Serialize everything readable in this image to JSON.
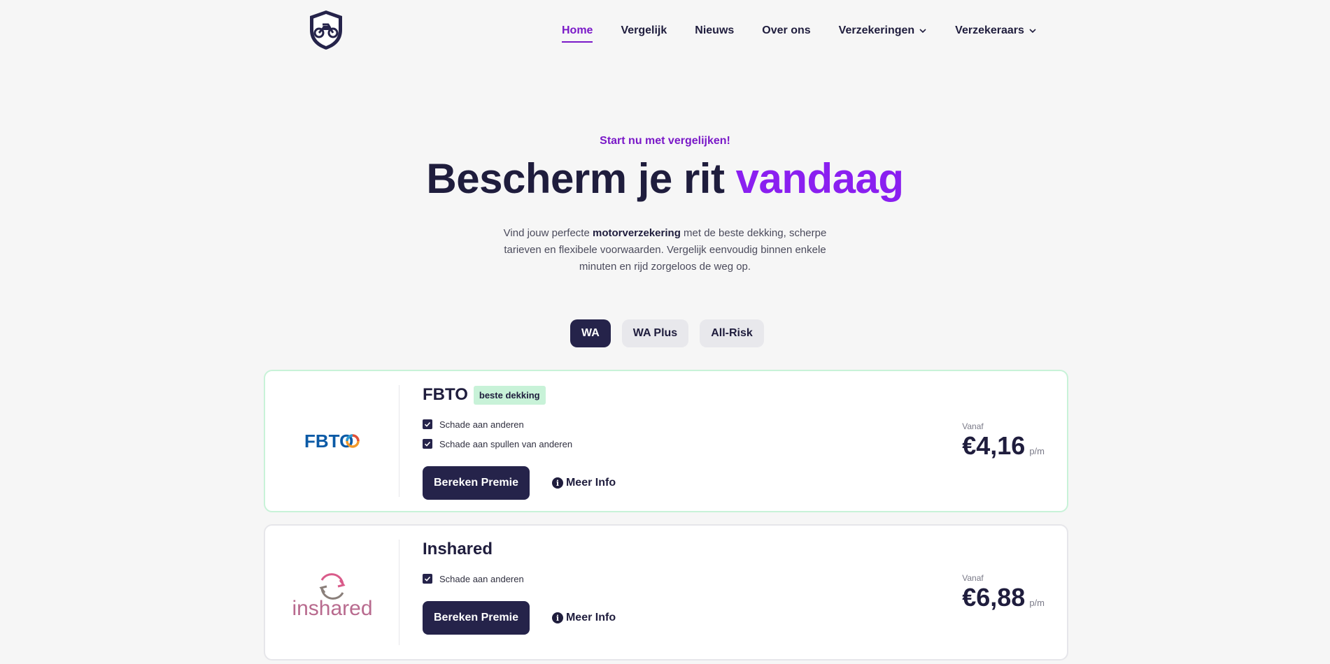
{
  "nav": {
    "items": [
      {
        "label": "Home",
        "active": true
      },
      {
        "label": "Vergelijk"
      },
      {
        "label": "Nieuws"
      },
      {
        "label": "Over ons"
      },
      {
        "label": "Verzekeringen",
        "dropdown": true
      },
      {
        "label": "Verzekeraars",
        "dropdown": true
      }
    ]
  },
  "hero": {
    "eyebrow": "Start nu met vergelijken!",
    "headline_main": "Bescherm je rit ",
    "headline_accent": "vandaag",
    "intro_before": "Vind jouw perfecte ",
    "intro_bold": "motorverzekering",
    "intro_after": " met de beste dekking, scherpe tarieven en flexibele voorwaarden. Vergelijk eenvoudig binnen enkele minuten en rijd zorgeloos de weg op."
  },
  "tabs": [
    {
      "label": "WA",
      "active": true
    },
    {
      "label": "WA Plus"
    },
    {
      "label": "All-Risk"
    }
  ],
  "cards": [
    {
      "insurer": "FBTO",
      "logo_text": "FBTO",
      "badge": "beste dekking",
      "features": [
        "Schade aan anderen",
        "Schade aan spullen van anderen"
      ],
      "cta": "Bereken Premie",
      "info": "Meer Info",
      "price_from": "Vanaf",
      "price": "€4,16",
      "price_unit": "p/m"
    },
    {
      "insurer": "Inshared",
      "logo_text": "inshared",
      "features": [
        "Schade aan anderen"
      ],
      "cta": "Bereken Premie",
      "info": "Meer Info",
      "price_from": "Vanaf",
      "price": "€6,88",
      "price_unit": "p/m"
    }
  ],
  "colors": {
    "brand_purple": "#7a19c8",
    "headline_accent": "#8a1ff0",
    "navy": "#25234a",
    "badge_green": "#c8f2d8"
  }
}
